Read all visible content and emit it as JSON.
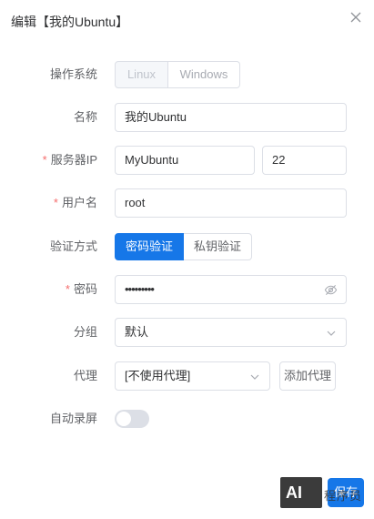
{
  "dialog": {
    "title": "编辑【我的Ubuntu】"
  },
  "os": {
    "label": "操作系统",
    "options": [
      "Linux",
      "Windows"
    ]
  },
  "name": {
    "label": "名称",
    "value": "我的Ubuntu"
  },
  "server": {
    "required_mark": "*",
    "label": "服务器IP",
    "host": "MyUbuntu",
    "port": "22"
  },
  "username": {
    "required_mark": "*",
    "label": "用户名",
    "value": "root"
  },
  "auth": {
    "label": "验证方式",
    "options": [
      "密码验证",
      "私钥验证"
    ],
    "selected": "密码验证"
  },
  "password": {
    "required_mark": "*",
    "label": "密码",
    "value": "•••••••••"
  },
  "group": {
    "label": "分组",
    "value": "默认"
  },
  "proxy": {
    "label": "代理",
    "value": "[不使用代理]",
    "add_button": "添加代理"
  },
  "auto_record": {
    "label": "自动录屏",
    "enabled": false
  },
  "footer": {
    "save_button": "保存"
  },
  "watermark": {
    "logo": "AI",
    "text": "程序员"
  },
  "colors": {
    "primary": "#1677e8",
    "required": "#f56c6c",
    "border": "#dcdfe6"
  },
  "icons": {
    "close": "close-icon",
    "chevron": "chevron-down-icon",
    "eye": "eye-slash-icon"
  }
}
